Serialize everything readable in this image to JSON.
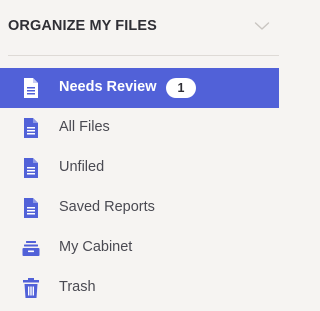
{
  "header": {
    "title": "ORGANIZE MY FILES",
    "toggle_icon": "chevron-down-icon"
  },
  "colors": {
    "accent": "#5161d8",
    "background": "#f6f4f2",
    "icon": "#5161d8",
    "text": "#4a4a52"
  },
  "nav": {
    "items": [
      {
        "label": "Needs Review",
        "icon": "document-icon",
        "active": true,
        "badge": "1"
      },
      {
        "label": "All Files",
        "icon": "document-icon",
        "active": false
      },
      {
        "label": "Unfiled",
        "icon": "document-icon",
        "active": false
      },
      {
        "label": "Saved Reports",
        "icon": "document-icon",
        "active": false
      },
      {
        "label": "My Cabinet",
        "icon": "cabinet-icon",
        "active": false
      },
      {
        "label": "Trash",
        "icon": "trash-icon",
        "active": false
      }
    ]
  }
}
